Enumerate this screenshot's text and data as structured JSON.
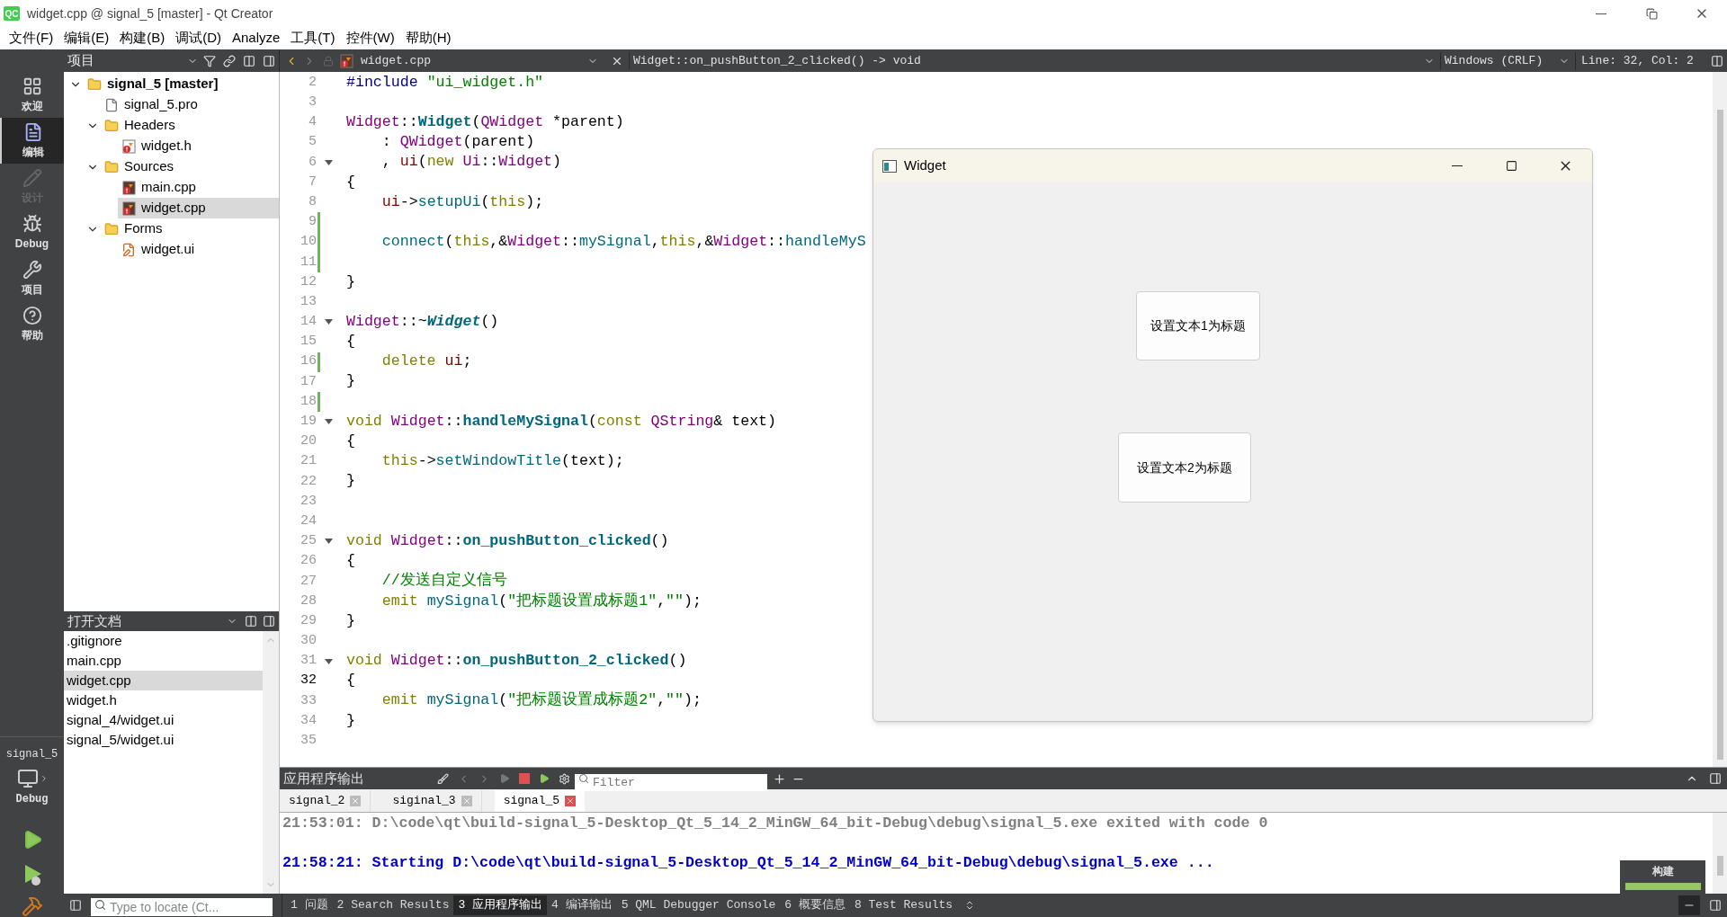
{
  "title_bar": {
    "logo": "QC",
    "title": "widget.cpp @ signal_5 [master] - Qt Creator"
  },
  "menu": [
    "文件(F)",
    "编辑(E)",
    "构建(B)",
    "调试(D)",
    "Analyze",
    "工具(T)",
    "控件(W)",
    "帮助(H)"
  ],
  "sidebar_header": {
    "title": "项目"
  },
  "editor_toolbar": {
    "file": "widget.cpp",
    "symbol": "Widget::on_pushButton_2_clicked() -> void",
    "line_ending": "Windows (CRLF)",
    "position": "Line: 32, Col: 2"
  },
  "modes": [
    {
      "kind": "welcome",
      "label": "欢迎",
      "selected": false,
      "disabled": false
    },
    {
      "kind": "edit",
      "label": "编辑",
      "selected": true,
      "disabled": false
    },
    {
      "kind": "design",
      "label": "设计",
      "selected": false,
      "disabled": true
    },
    {
      "kind": "debug",
      "label": "Debug",
      "selected": false,
      "disabled": false
    },
    {
      "kind": "projects",
      "label": "项目",
      "selected": false,
      "disabled": false
    },
    {
      "kind": "help",
      "label": "帮助",
      "selected": false,
      "disabled": false
    }
  ],
  "target": {
    "project": "signal_5",
    "build": "Debug"
  },
  "project_tree": {
    "items": [
      {
        "kind": "project",
        "label": "signal_5 [master]",
        "expanded": true,
        "selected": false,
        "children": [
          {
            "kind": "project-file",
            "label": "signal_5.pro",
            "selected": false
          },
          {
            "kind": "folder",
            "label": "Headers",
            "expanded": true,
            "selected": false,
            "children": [
              {
                "kind": "header",
                "label": "widget.h",
                "selected": false
              }
            ]
          },
          {
            "kind": "folder",
            "label": "Sources",
            "expanded": true,
            "selected": false,
            "children": [
              {
                "kind": "source",
                "label": "main.cpp",
                "selected": false
              },
              {
                "kind": "source",
                "label": "widget.cpp",
                "selected": true
              }
            ]
          },
          {
            "kind": "folder",
            "label": "Forms",
            "expanded": true,
            "selected": false,
            "children": [
              {
                "kind": "form",
                "label": "widget.ui",
                "selected": false
              }
            ]
          }
        ]
      }
    ]
  },
  "open_documents": {
    "title": "打开文档",
    "items": [
      {
        "label": ".gitignore",
        "selected": false
      },
      {
        "label": "main.cpp",
        "selected": false
      },
      {
        "label": "widget.cpp",
        "selected": true
      },
      {
        "label": "widget.h",
        "selected": false
      },
      {
        "label": "signal_4/widget.ui",
        "selected": false
      },
      {
        "label": "signal_5/widget.ui",
        "selected": false
      }
    ]
  },
  "editor": {
    "lines": [
      {
        "n": "2",
        "modified": false,
        "current": false,
        "fold": false,
        "tokens": [
          {
            "text": "#include ",
            "kind": "preprocessor"
          },
          {
            "text": "\"ui_widget.h\"",
            "kind": "string"
          }
        ]
      },
      {
        "n": "3",
        "modified": false,
        "current": false,
        "fold": false
      },
      {
        "n": "4",
        "modified": false,
        "current": false,
        "fold": false,
        "tokens": [
          {
            "text": "Widget",
            "kind": "type"
          },
          {
            "text": "::",
            "kind": "plain"
          },
          {
            "text": "Widget",
            "kind": "declaration"
          },
          {
            "text": "(",
            "kind": "plain"
          },
          {
            "text": "QWidget",
            "kind": "type"
          },
          {
            "text": " *parent)",
            "kind": "plain"
          }
        ]
      },
      {
        "n": "5",
        "modified": false,
        "current": false,
        "fold": false,
        "tokens": [
          {
            "text": "    : ",
            "kind": "plain"
          },
          {
            "text": "QWidget",
            "kind": "type"
          },
          {
            "text": "(parent)",
            "kind": "plain"
          }
        ]
      },
      {
        "n": "6",
        "modified": false,
        "current": false,
        "fold": true,
        "tokens": [
          {
            "text": "    , ",
            "kind": "plain"
          },
          {
            "text": "ui",
            "kind": "member"
          },
          {
            "text": "(",
            "kind": "plain"
          },
          {
            "text": "new ",
            "kind": "keyword"
          },
          {
            "text": "Ui",
            "kind": "type"
          },
          {
            "text": "::",
            "kind": "plain"
          },
          {
            "text": "Widget",
            "kind": "type"
          },
          {
            "text": ")",
            "kind": "plain"
          }
        ]
      },
      {
        "n": "7",
        "modified": false,
        "current": false,
        "fold": false,
        "tokens": [
          {
            "text": "{",
            "kind": "plain"
          }
        ]
      },
      {
        "n": "8",
        "modified": false,
        "current": false,
        "fold": false,
        "tokens": [
          {
            "text": "    ui",
            "kind": "member"
          },
          {
            "text": "->",
            "kind": "plain"
          },
          {
            "text": "setupUi",
            "kind": "function"
          },
          {
            "text": "(",
            "kind": "plain"
          },
          {
            "text": "this",
            "kind": "keyword"
          },
          {
            "text": ");",
            "kind": "plain"
          }
        ]
      },
      {
        "n": "9",
        "modified": true,
        "current": false,
        "fold": false
      },
      {
        "n": "10",
        "modified": true,
        "current": false,
        "fold": false,
        "tokens": [
          {
            "text": "    connect",
            "kind": "function"
          },
          {
            "text": "(",
            "kind": "plain"
          },
          {
            "text": "this",
            "kind": "keyword"
          },
          {
            "text": ",&",
            "kind": "plain"
          },
          {
            "text": "Widget",
            "kind": "type"
          },
          {
            "text": "::",
            "kind": "plain"
          },
          {
            "text": "mySignal",
            "kind": "function"
          },
          {
            "text": ",",
            "kind": "plain"
          },
          {
            "text": "this",
            "kind": "keyword"
          },
          {
            "text": ",&",
            "kind": "plain"
          },
          {
            "text": "Widget",
            "kind": "type"
          },
          {
            "text": "::",
            "kind": "plain"
          },
          {
            "text": "handleMyS",
            "kind": "function"
          }
        ]
      },
      {
        "n": "11",
        "modified": true,
        "current": false,
        "fold": false
      },
      {
        "n": "12",
        "modified": false,
        "current": false,
        "fold": false,
        "tokens": [
          {
            "text": "}",
            "kind": "plain"
          }
        ]
      },
      {
        "n": "13",
        "modified": false,
        "current": false,
        "fold": false
      },
      {
        "n": "14",
        "modified": false,
        "current": false,
        "fold": true,
        "tokens": [
          {
            "text": "Widget",
            "kind": "type"
          },
          {
            "text": "::~",
            "kind": "plain"
          },
          {
            "text": "Widget",
            "kind": "destructor"
          },
          {
            "text": "()",
            "kind": "plain"
          }
        ]
      },
      {
        "n": "15",
        "modified": false,
        "current": false,
        "fold": false,
        "tokens": [
          {
            "text": "{",
            "kind": "plain"
          }
        ]
      },
      {
        "n": "16",
        "modified": true,
        "current": false,
        "fold": false,
        "tokens": [
          {
            "text": "    delete ",
            "kind": "keyword"
          },
          {
            "text": "ui",
            "kind": "member"
          },
          {
            "text": ";",
            "kind": "plain"
          }
        ]
      },
      {
        "n": "17",
        "modified": false,
        "current": false,
        "fold": false,
        "tokens": [
          {
            "text": "}",
            "kind": "plain"
          }
        ]
      },
      {
        "n": "18",
        "modified": true,
        "current": false,
        "fold": false
      },
      {
        "n": "19",
        "modified": false,
        "current": false,
        "fold": true,
        "tokens": [
          {
            "text": "void ",
            "kind": "keyword"
          },
          {
            "text": "Widget",
            "kind": "type"
          },
          {
            "text": "::",
            "kind": "plain"
          },
          {
            "text": "handleMySignal",
            "kind": "declaration"
          },
          {
            "text": "(",
            "kind": "plain"
          },
          {
            "text": "const ",
            "kind": "keyword"
          },
          {
            "text": "QString",
            "kind": "type"
          },
          {
            "text": "& text)",
            "kind": "plain"
          }
        ]
      },
      {
        "n": "20",
        "modified": false,
        "current": false,
        "fold": false,
        "tokens": [
          {
            "text": "{",
            "kind": "plain"
          }
        ]
      },
      {
        "n": "21",
        "modified": false,
        "current": false,
        "fold": false,
        "tokens": [
          {
            "text": "    this",
            "kind": "keyword"
          },
          {
            "text": "->",
            "kind": "plain"
          },
          {
            "text": "setWindowTitle",
            "kind": "function"
          },
          {
            "text": "(text);",
            "kind": "plain"
          }
        ]
      },
      {
        "n": "22",
        "modified": false,
        "current": false,
        "fold": false,
        "tokens": [
          {
            "text": "}",
            "kind": "plain"
          }
        ]
      },
      {
        "n": "23",
        "modified": false,
        "current": false,
        "fold": false
      },
      {
        "n": "24",
        "modified": false,
        "current": false,
        "fold": false
      },
      {
        "n": "25",
        "modified": false,
        "current": false,
        "fold": true,
        "tokens": [
          {
            "text": "void ",
            "kind": "keyword"
          },
          {
            "text": "Widget",
            "kind": "type"
          },
          {
            "text": "::",
            "kind": "plain"
          },
          {
            "text": "on_pushButton_clicked",
            "kind": "declaration"
          },
          {
            "text": "()",
            "kind": "plain"
          }
        ]
      },
      {
        "n": "26",
        "modified": false,
        "current": false,
        "fold": false,
        "tokens": [
          {
            "text": "{",
            "kind": "plain"
          }
        ]
      },
      {
        "n": "27",
        "modified": false,
        "current": false,
        "fold": false,
        "tokens": [
          {
            "text": "    //发送自定义信号",
            "kind": "comment"
          }
        ]
      },
      {
        "n": "28",
        "modified": false,
        "current": false,
        "fold": false,
        "tokens": [
          {
            "text": "    emit ",
            "kind": "keyword"
          },
          {
            "text": "mySignal",
            "kind": "function"
          },
          {
            "text": "(",
            "kind": "plain"
          },
          {
            "text": "\"把标题设置成标题1\"",
            "kind": "string"
          },
          {
            "text": ",",
            "kind": "plain"
          },
          {
            "text": "\"\"",
            "kind": "string"
          },
          {
            "text": ");",
            "kind": "plain"
          }
        ]
      },
      {
        "n": "29",
        "modified": false,
        "current": false,
        "fold": false,
        "tokens": [
          {
            "text": "}",
            "kind": "plain"
          }
        ]
      },
      {
        "n": "30",
        "modified": false,
        "current": false,
        "fold": false
      },
      {
        "n": "31",
        "modified": false,
        "current": false,
        "fold": true,
        "tokens": [
          {
            "text": "void ",
            "kind": "keyword"
          },
          {
            "text": "Widget",
            "kind": "type"
          },
          {
            "text": "::",
            "kind": "plain"
          },
          {
            "text": "on_pushButton_2_clicked",
            "kind": "declaration"
          },
          {
            "text": "()",
            "kind": "plain"
          }
        ]
      },
      {
        "n": "32",
        "modified": false,
        "current": true,
        "fold": false,
        "tokens": [
          {
            "text": "{",
            "kind": "plain"
          }
        ]
      },
      {
        "n": "33",
        "modified": false,
        "current": false,
        "fold": false,
        "tokens": [
          {
            "text": "    emit ",
            "kind": "keyword"
          },
          {
            "text": "mySignal",
            "kind": "function"
          },
          {
            "text": "(",
            "kind": "plain"
          },
          {
            "text": "\"把标题设置成标题2\"",
            "kind": "string"
          },
          {
            "text": ",",
            "kind": "plain"
          },
          {
            "text": "\"\"",
            "kind": "string"
          },
          {
            "text": ");",
            "kind": "plain"
          }
        ]
      },
      {
        "n": "34",
        "modified": false,
        "current": false,
        "fold": false,
        "tokens": [
          {
            "text": "}",
            "kind": "plain"
          }
        ]
      },
      {
        "n": "35",
        "modified": false,
        "current": false,
        "fold": false
      }
    ]
  },
  "widget_window": {
    "title": "Widget",
    "buttons": [
      "设置文本1为标题",
      "设置文本2为标题"
    ]
  },
  "output": {
    "title": "应用程序输出",
    "filter_placeholder": "Filter",
    "tabs": [
      {
        "label": "signal_2",
        "selected": false
      },
      {
        "label": "siginal_3",
        "selected": false
      },
      {
        "label": "signal_5",
        "selected": true
      }
    ],
    "lines": [
      {
        "kind": "exit",
        "text": "21:53:01: D:\\code\\qt\\build-signal_5-Desktop_Qt_5_14_2_MinGW_64_bit-Debug\\debug\\signal_5.exe exited with code 0"
      },
      {
        "kind": "start",
        "text": "21:58:21: Starting D:\\code\\qt\\build-signal_5-Desktop_Qt_5_14_2_MinGW_64_bit-Debug\\debug\\signal_5.exe ..."
      }
    ]
  },
  "build_progress": {
    "label": "构建",
    "level": 1
  },
  "status_bar": {
    "locator_placeholder": "Type to locate (Ct...",
    "panes": [
      {
        "label": "1 问题",
        "selected": false
      },
      {
        "label": "2 Search Results",
        "selected": false
      },
      {
        "label": "3 应用程序输出",
        "selected": true
      },
      {
        "label": "4 编译输出",
        "selected": false
      },
      {
        "label": "5 QML Debugger Console",
        "selected": false
      },
      {
        "label": "6 概要信息",
        "selected": false
      },
      {
        "label": "8 Test Results",
        "selected": false
      }
    ]
  }
}
